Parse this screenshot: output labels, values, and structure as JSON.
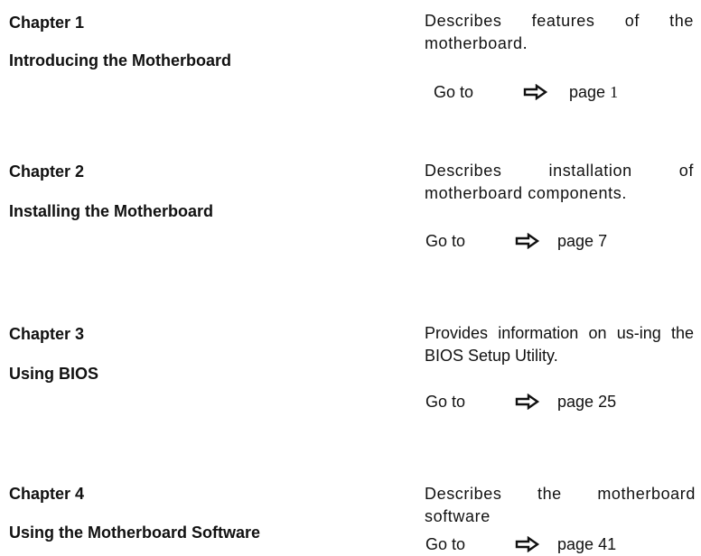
{
  "chapters": [
    {
      "number_label": "Chapter 1",
      "title": "Introducing the Motherboard",
      "description": "Describes features of the motherboard.",
      "goto_label": "Go to",
      "page_word": "page",
      "page_number": "1"
    },
    {
      "number_label": "Chapter 2",
      "title": "Installing the Motherboard",
      "description": "Describes installation of motherboard components.",
      "goto_label": "Go to",
      "page_word": "page",
      "page_number": "7"
    },
    {
      "number_label": "Chapter 3",
      "title": "Using BIOS",
      "description": "Provides information on us-ing the BIOS Setup Utility.",
      "goto_label": "Go to",
      "page_word": "page",
      "page_number": "25"
    },
    {
      "number_label": "Chapter 4",
      "title": "Using the Motherboard Software",
      "description": "Describes the motherboard software",
      "goto_label": "Go to",
      "page_word": "page",
      "page_number": "41"
    }
  ],
  "icons": {
    "goto_arrow": "right-arrow-icon"
  },
  "colors": {
    "text": "#111111",
    "background": "#ffffff"
  }
}
